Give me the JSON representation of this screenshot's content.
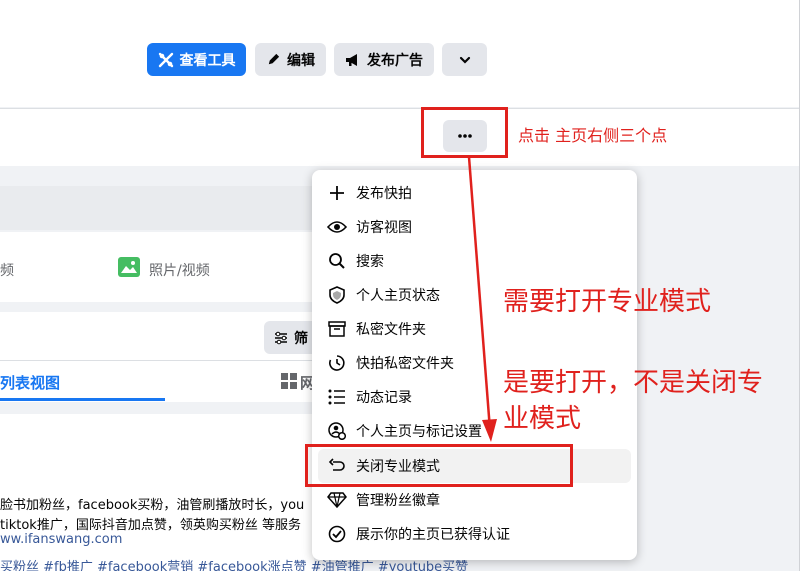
{
  "header": {
    "view_tools": "查看工具",
    "edit": "编辑",
    "publish_ad": "发布广告"
  },
  "content": {
    "composer_video_fragment": "频",
    "composer_photo": "照片/视频",
    "filter_fragment": "筛",
    "tab_list_view_fragment": "列表视图",
    "tab_grid_fragment": "网",
    "post_link": "ww.ifanswang.com",
    "post_line1": "脸书加粉丝，facebook买粉，油管刷播放时长，you",
    "post_line2": "tiktok推广，国际抖音加点赞，领英购买粉丝 等服务",
    "post_tags": "买粉丝 #fb推广 #facebook营销 #facebook涨点赞 #油管推广 #youtube买赞"
  },
  "menu": {
    "items": [
      {
        "label": "发布快拍",
        "icon": "plus-icon"
      },
      {
        "label": "访客视图",
        "icon": "eye-icon"
      },
      {
        "label": "搜索",
        "icon": "search-icon"
      },
      {
        "label": "个人主页状态",
        "icon": "shield-icon"
      },
      {
        "label": "私密文件夹",
        "icon": "archive-icon"
      },
      {
        "label": "快拍私密文件夹",
        "icon": "clock-archive-icon"
      },
      {
        "label": "动态记录",
        "icon": "list-icon"
      },
      {
        "label": "个人主页与标记设置",
        "icon": "profile-gear-icon"
      },
      {
        "label": "关闭专业模式",
        "icon": "undo-icon"
      },
      {
        "label": "管理粉丝徽章",
        "icon": "diamond-icon"
      },
      {
        "label": "展示你的主页已获得认证",
        "icon": "check-circle-icon"
      }
    ]
  },
  "annotations": {
    "click_note": "点击 主页右侧三个点",
    "need_note": "需要打开专业模式",
    "note_line1": "是要打开，不是关闭专",
    "note_line2": "业模式"
  },
  "colors": {
    "primary": "#1877f2",
    "annotation_red": "#e0211d"
  }
}
